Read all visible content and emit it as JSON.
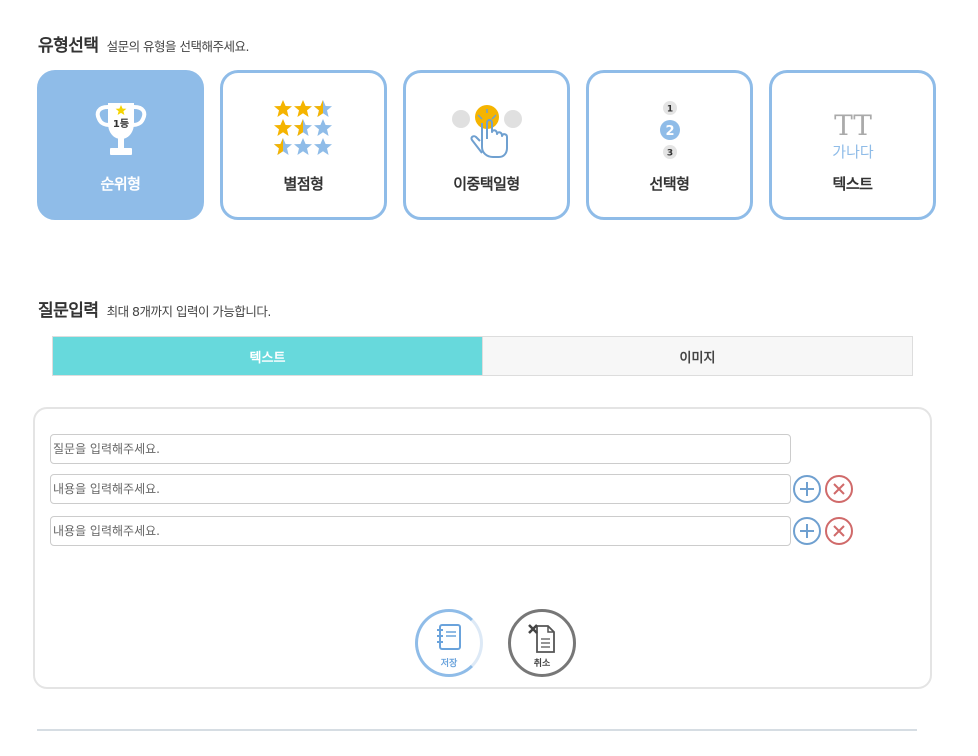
{
  "type_section": {
    "title": "유형선택",
    "description": "설문의 유형을 선택해주세요."
  },
  "type_cards": [
    {
      "label": "순위형",
      "icon": "trophy-icon",
      "active": true,
      "trophy_text": "1등"
    },
    {
      "label": "별점형",
      "icon": "stars-icon",
      "active": false
    },
    {
      "label": "이중택일형",
      "icon": "touch-choice-icon",
      "active": false
    },
    {
      "label": "선택형",
      "icon": "numbered-choice-icon",
      "active": false,
      "choice_numbers": [
        "1",
        "2",
        "3"
      ]
    },
    {
      "label": "텍스트",
      "icon": "text-type-icon",
      "active": false,
      "icon_text_top": "TT",
      "icon_text_bottom": "가나다"
    }
  ],
  "question_section": {
    "title": "질문입력",
    "description": "최대 8개까지 입력이 가능합니다."
  },
  "tabs": [
    {
      "label": "텍스트",
      "active": true
    },
    {
      "label": "이미지",
      "active": false
    }
  ],
  "form": {
    "question_placeholder": "질문을 입력해주세요.",
    "option_placeholders": [
      "내용을 입력해주세요.",
      "내용을 입력해주세요."
    ]
  },
  "actions": {
    "save_label": "저장",
    "cancel_label": "취소"
  },
  "colors": {
    "accent_blue": "#8fbce8",
    "tab_active": "#67d9dc",
    "add_button": "#6fa0d0",
    "remove_button": "#d06a6a",
    "star_gold": "#f5b400"
  }
}
